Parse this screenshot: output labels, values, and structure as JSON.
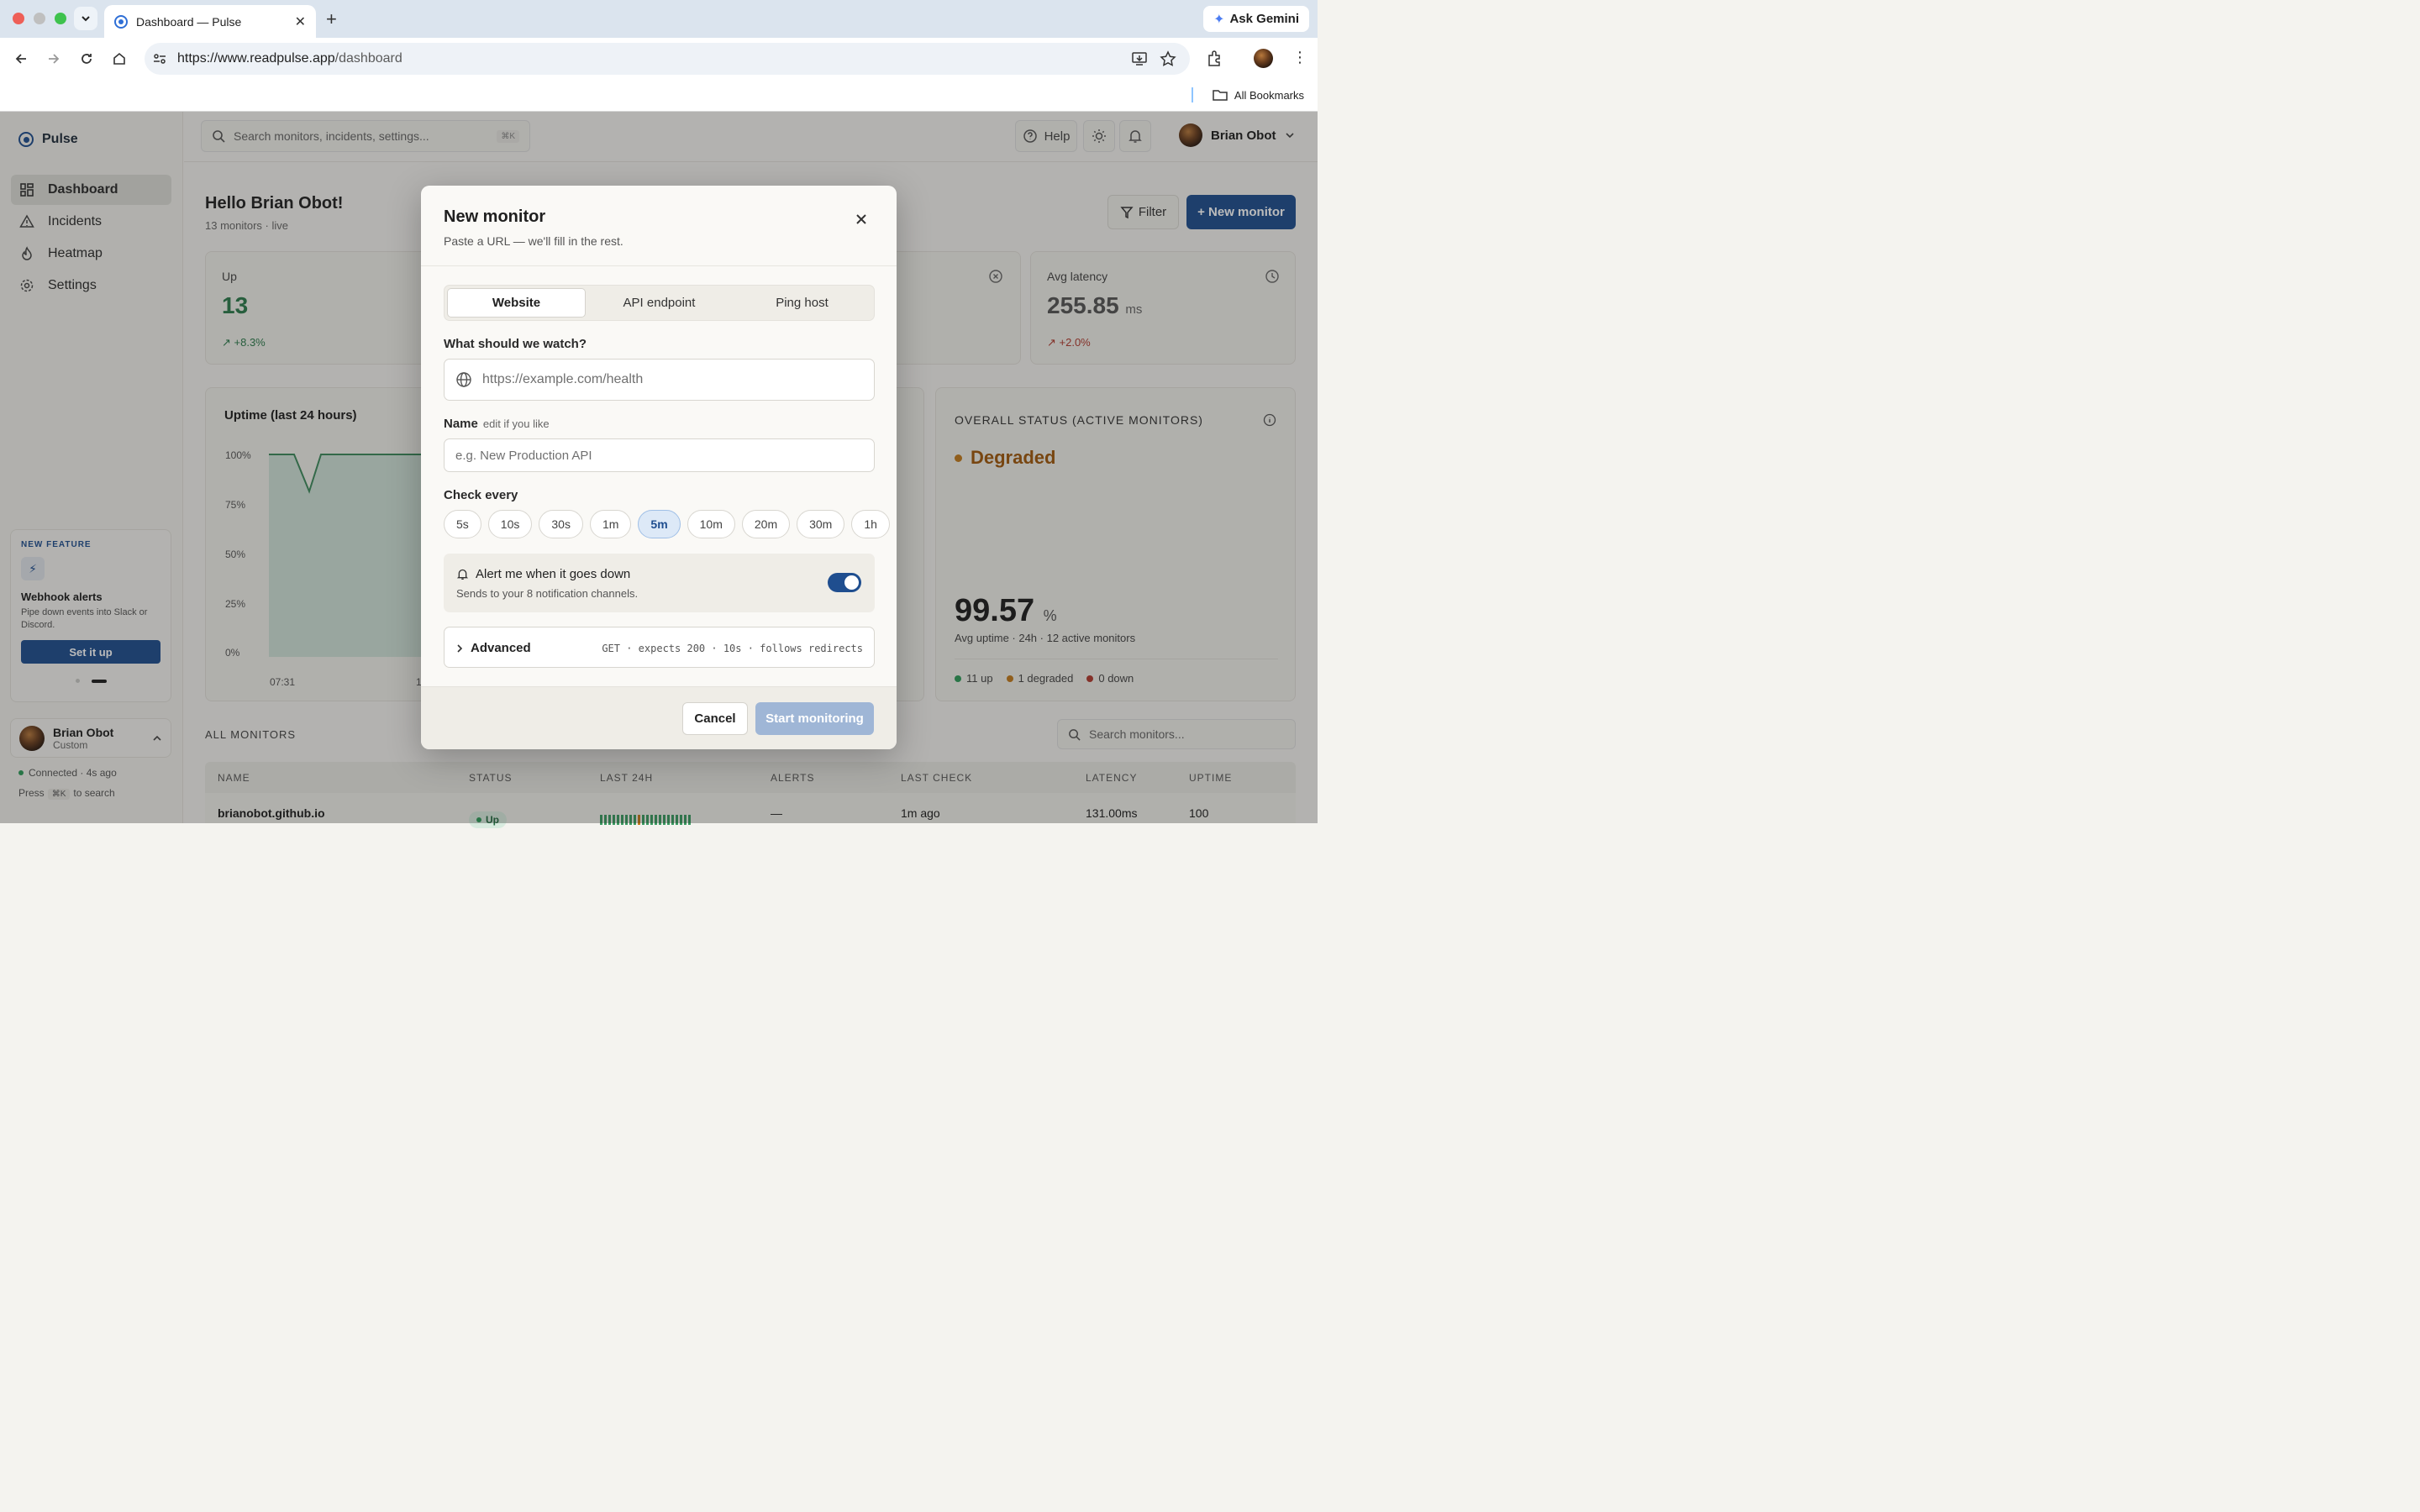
{
  "browser": {
    "tab_title": "Dashboard — Pulse",
    "url_host": "https://www.readpulse.app",
    "url_path": "/dashboard",
    "ask_gemini": "Ask Gemini",
    "all_bookmarks": "All Bookmarks"
  },
  "app": {
    "brand": "Pulse",
    "nav": [
      {
        "label": "Dashboard",
        "active": true
      },
      {
        "label": "Incidents"
      },
      {
        "label": "Heatmap"
      },
      {
        "label": "Settings"
      }
    ],
    "promo": {
      "tag": "NEW FEATURE",
      "title": "Webhook alerts",
      "text": "Pipe down events into Slack or Discord.",
      "button": "Set it up"
    },
    "user": {
      "name": "Brian Obot",
      "plan": "Custom"
    },
    "connection": "Connected · 4s ago",
    "press_hint_a": "Press",
    "press_hint_key": "⌘K",
    "press_hint_b": "to search"
  },
  "topbar": {
    "search_placeholder": "Search monitors, incidents, settings...",
    "search_shortcut": "⌘K",
    "help": "Help",
    "user_name": "Brian Obot"
  },
  "dashboard": {
    "greeting": "Hello Brian Obot!",
    "subtitle": "13 monitors · live",
    "filter": "Filter",
    "new_monitor": "+ New monitor",
    "stats": [
      {
        "label": "Up",
        "value": "13",
        "delta": "+8.3%"
      },
      {
        "label": "Avg latency",
        "value": "255.85",
        "unit": "ms",
        "delta": "+2.0%"
      }
    ],
    "uptime_title": "Uptime (last 24 hours)",
    "y_ticks": [
      "100%",
      "75%",
      "50%",
      "25%",
      "0%"
    ],
    "x_ticks": [
      "07:31",
      "1"
    ],
    "overall_title": "OVERALL STATUS (ACTIVE MONITORS)",
    "overall_state": "Degraded",
    "avg_uptime_value": "99.57",
    "avg_uptime_unit": "%",
    "avg_uptime_caption": "Avg uptime · 24h · 12 active monitors",
    "legend": [
      "11 up",
      "1 degraded",
      "0 down"
    ],
    "all_monitors": "ALL MONITORS",
    "monitor_search": "Search monitors...",
    "columns": [
      "NAME",
      "STATUS",
      "LAST 24H",
      "ALERTS",
      "LAST CHECK",
      "LATENCY",
      "UPTIME"
    ],
    "rows": [
      {
        "name": "brianobot.github.io",
        "status": "Up",
        "alerts": "—",
        "last_check": "1m ago",
        "latency": "131.00ms",
        "uptime": "100"
      }
    ]
  },
  "modal": {
    "title": "New monitor",
    "subtitle": "Paste a URL — we'll fill in the rest.",
    "tabs": [
      "Website",
      "API endpoint",
      "Ping host"
    ],
    "active_tab": "Website",
    "watch_label": "What should we watch?",
    "watch_placeholder": "https://example.com/health",
    "name_label": "Name",
    "name_hint": "edit if you like",
    "name_placeholder": "e.g. New Production API",
    "check_label": "Check every",
    "intervals": [
      "5s",
      "10s",
      "30s",
      "1m",
      "5m",
      "10m",
      "20m",
      "30m",
      "1h"
    ],
    "selected_interval": "5m",
    "alert_title": "Alert me when it goes down",
    "alert_sub": "Sends to your 8 notification channels.",
    "alert_enabled": true,
    "advanced_label": "Advanced",
    "advanced_summary": "GET · expects 200 · 10s · follows redirects",
    "cancel": "Cancel",
    "start": "Start monitoring"
  },
  "colors": {
    "accent": "#1f4e8f",
    "up": "#2e9b5a",
    "degraded": "#c27a1c",
    "down": "#b03a2e"
  }
}
